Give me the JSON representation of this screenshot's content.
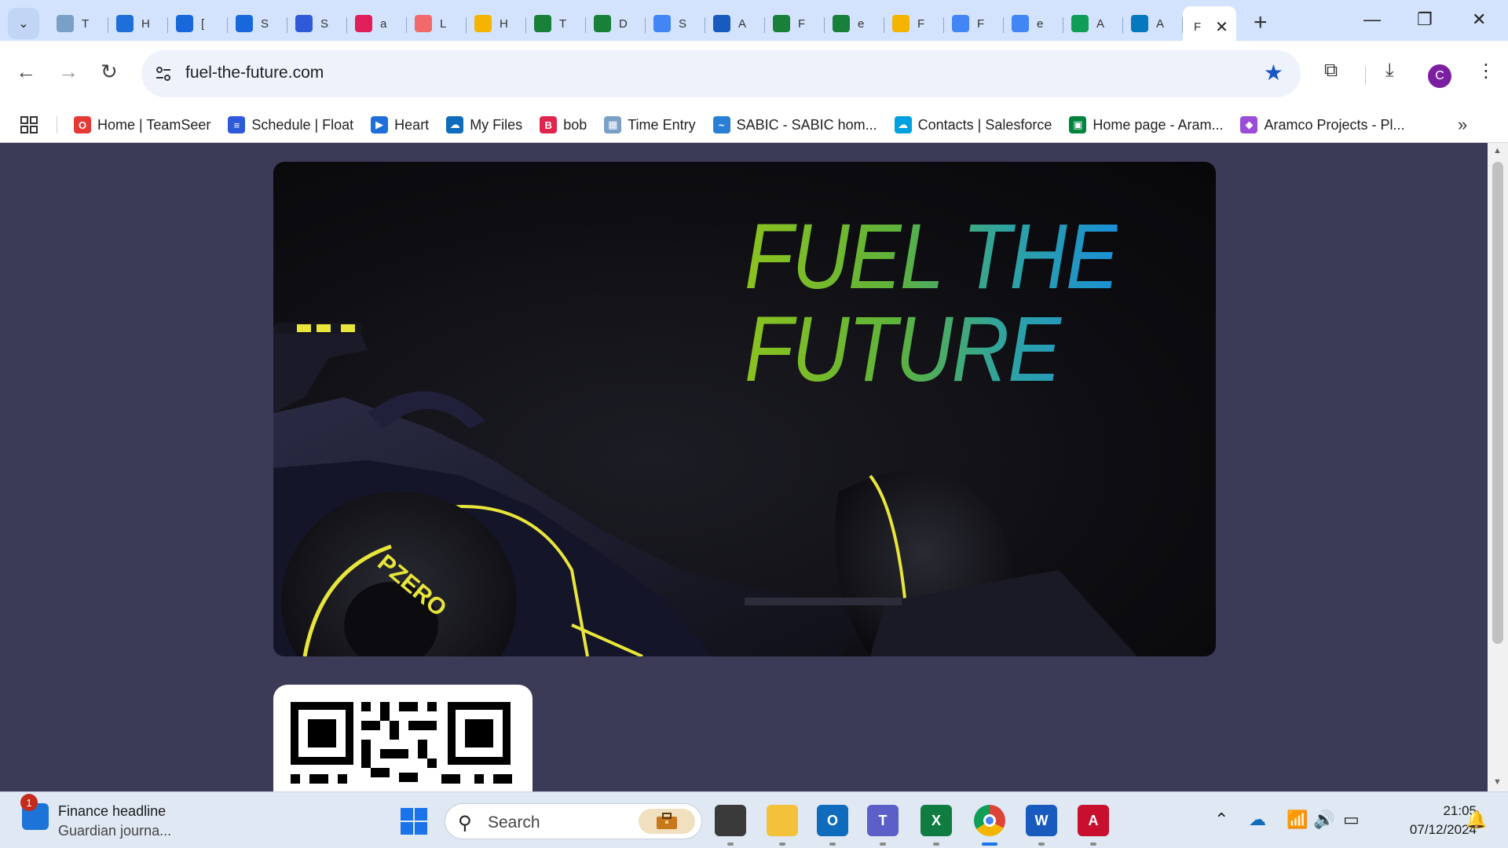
{
  "browser": {
    "tabs": [
      {
        "letter": "T",
        "icon": "timeentry-icon",
        "color": "#7aa0c8"
      },
      {
        "letter": "H",
        "icon": "heart-icon",
        "color": "#1e6fd9"
      },
      {
        "letter": "[",
        "icon": "jira-icon",
        "color": "#1868db"
      },
      {
        "letter": "S",
        "icon": "confluence-icon",
        "color": "#1868db"
      },
      {
        "letter": "S",
        "icon": "float-icon",
        "color": "#2e59d9"
      },
      {
        "letter": "a",
        "icon": "slack-icon",
        "color": "#e01e5a"
      },
      {
        "letter": "L",
        "icon": "asana-icon",
        "color": "#f06a6a"
      },
      {
        "letter": "H",
        "icon": "drive-icon",
        "color": "#f4b400"
      },
      {
        "letter": "T",
        "icon": "sheets-icon",
        "color": "#188038"
      },
      {
        "letter": "D",
        "icon": "sheets-icon",
        "color": "#188038"
      },
      {
        "letter": "S",
        "icon": "docs-icon",
        "color": "#4285f4"
      },
      {
        "letter": "A",
        "icon": "word-icon",
        "color": "#185abd"
      },
      {
        "letter": "F",
        "icon": "sheets-icon",
        "color": "#188038"
      },
      {
        "letter": "e",
        "icon": "sheets-icon",
        "color": "#188038"
      },
      {
        "letter": "F",
        "icon": "drive-icon",
        "color": "#f4b400"
      },
      {
        "letter": "F",
        "icon": "docs-icon",
        "color": "#4285f4"
      },
      {
        "letter": "e",
        "icon": "docs-icon",
        "color": "#4285f4"
      },
      {
        "letter": "A",
        "icon": "drive-icon",
        "color": "#0f9d58"
      },
      {
        "letter": "A",
        "icon": "drupal-icon",
        "color": "#0678be"
      }
    ],
    "active_tab": {
      "letter": "F",
      "close": "✕"
    },
    "new_tab": "+",
    "url": "fuel-the-future.com",
    "profile_initial": "C",
    "bookmarks": [
      {
        "label": "Home | TeamSeer",
        "color": "#e53935",
        "glyph": "O"
      },
      {
        "label": "Schedule | Float",
        "color": "#2e59d9",
        "glyph": "≡"
      },
      {
        "label": "Heart",
        "color": "#1e6fd9",
        "glyph": "▶"
      },
      {
        "label": "My Files",
        "color": "#0f6cbd",
        "glyph": "☁"
      },
      {
        "label": "bob",
        "color": "#e0244d",
        "glyph": "B"
      },
      {
        "label": "Time Entry",
        "color": "#7aa0c8",
        "glyph": "▦"
      },
      {
        "label": "SABIC - SABIC hom...",
        "color": "#2a7fd4",
        "glyph": "~"
      },
      {
        "label": "Contacts | Salesforce",
        "color": "#00a1e0",
        "glyph": "☁"
      },
      {
        "label": "Home page - Aram...",
        "color": "#00843d",
        "glyph": "▣"
      },
      {
        "label": "Aramco Projects - Pl...",
        "color": "#9b4dd8",
        "glyph": "◆"
      }
    ],
    "bookmarks_more": "»"
  },
  "page": {
    "hero_line1": "FUEL THE",
    "hero_line2": "FUTURE",
    "tyre_text": "PZERO"
  },
  "taskbar": {
    "widget_badge": "1",
    "widget_title": "Finance headline",
    "widget_subtitle": "Guardian journa...",
    "search_placeholder": "Search",
    "apps": [
      {
        "name": "task-view",
        "label": "",
        "color": "#3a3a3a"
      },
      {
        "name": "file-explorer",
        "label": "",
        "color": "#f3c13a"
      },
      {
        "name": "outlook",
        "label": "O",
        "color": "#0f6cbd"
      },
      {
        "name": "teams",
        "label": "T",
        "color": "#5b5fc7"
      },
      {
        "name": "excel",
        "label": "X",
        "color": "#107c41"
      },
      {
        "name": "chrome",
        "label": "",
        "color": "#ffffff"
      },
      {
        "name": "word",
        "label": "W",
        "color": "#185abd"
      },
      {
        "name": "acrobat",
        "label": "A",
        "color": "#c8102e"
      }
    ],
    "time": "21:05",
    "date": "07/12/2024"
  }
}
